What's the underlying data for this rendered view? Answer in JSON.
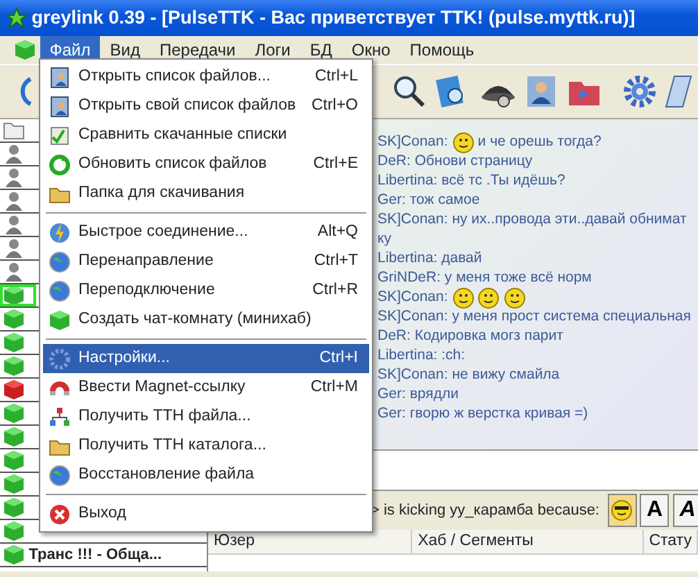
{
  "window": {
    "title": "greylink 0.39 - [PulseTTK - Вас приветствует TTK! (pulse.myttk.ru)]"
  },
  "menubar": [
    {
      "label": "Файл",
      "selected": true
    },
    {
      "label": "Вид",
      "selected": false
    },
    {
      "label": "Передачи",
      "selected": false
    },
    {
      "label": "Логи",
      "selected": false
    },
    {
      "label": "БД",
      "selected": false
    },
    {
      "label": "Окно",
      "selected": false
    },
    {
      "label": "Помощь",
      "selected": false
    }
  ],
  "file_menu": [
    {
      "kind": "list",
      "label": "Открыть список файлов...",
      "shortcut": "Ctrl+L",
      "selected": false
    },
    {
      "kind": "list",
      "label": "Открыть свой список файлов",
      "shortcut": "Ctrl+O",
      "selected": false
    },
    {
      "kind": "compare",
      "label": "Сравнить скачанные списки",
      "selected": false
    },
    {
      "kind": "refresh",
      "label": "Обновить список файлов",
      "shortcut": "Ctrl+E",
      "selected": false
    },
    {
      "kind": "folder",
      "label": "Папка для скачивания",
      "selected": false
    },
    {
      "kind": "separator"
    },
    {
      "kind": "bolt",
      "label": "Быстрое соединение...",
      "shortcut": "Alt+Q",
      "selected": false
    },
    {
      "kind": "globe",
      "label": "Перенаправление",
      "shortcut": "Ctrl+T",
      "selected": false
    },
    {
      "kind": "globe",
      "label": "Переподключение",
      "shortcut": "Ctrl+R",
      "selected": false
    },
    {
      "kind": "cube",
      "label": "Создать чат-комнату (минихаб)",
      "selected": false
    },
    {
      "kind": "separator"
    },
    {
      "kind": "gear",
      "label": "Настройки...",
      "shortcut": "Ctrl+I",
      "selected": true
    },
    {
      "kind": "magnet",
      "label": "Ввести Magnet-ссылку",
      "shortcut": "Ctrl+M",
      "selected": false
    },
    {
      "kind": "tree",
      "label": "Получить TTH файла...",
      "selected": false
    },
    {
      "kind": "folder",
      "label": "Получить TTH каталога...",
      "selected": false
    },
    {
      "kind": "globe",
      "label": "Восстановление файла",
      "selected": false
    },
    {
      "kind": "separator"
    },
    {
      "kind": "exit",
      "label": "Выход",
      "selected": false
    }
  ],
  "hub_list": [
    {
      "kind": "folder",
      "selected": false
    },
    {
      "kind": "user",
      "selected": false
    },
    {
      "kind": "user",
      "selected": false
    },
    {
      "kind": "user",
      "selected": false
    },
    {
      "kind": "user",
      "selected": false
    },
    {
      "kind": "user",
      "selected": false
    },
    {
      "kind": "user",
      "selected": false
    },
    {
      "kind": "hub",
      "selected": true
    },
    {
      "kind": "hub",
      "selected": false
    },
    {
      "kind": "hub",
      "selected": false
    },
    {
      "kind": "hub",
      "selected": false
    },
    {
      "kind": "hub-offline",
      "selected": false
    },
    {
      "kind": "hub",
      "selected": false
    },
    {
      "kind": "hub",
      "selected": false
    },
    {
      "kind": "hub",
      "selected": false
    },
    {
      "kind": "hub",
      "selected": false
    },
    {
      "kind": "hub",
      "selected": false
    },
    {
      "kind": "hub",
      "selected": false
    },
    {
      "kind": "hub",
      "label": "Транс !!! - Обща...",
      "selected": false
    }
  ],
  "chat": [
    [
      {
        "kind": "text",
        "text": "SK]Conan:"
      },
      {
        "kind": "smiley"
      },
      {
        "kind": "text",
        "text": "и че орешь тогда?"
      }
    ],
    [
      {
        "kind": "text",
        "text": "DeR: Обнови страницу"
      }
    ],
    [
      {
        "kind": "text",
        "text": "Libertina:  всё  тс .Ты идёшь?"
      }
    ],
    [
      {
        "kind": "text",
        "text": "Ger: тож самое"
      }
    ],
    [
      {
        "kind": "text",
        "text": "SK]Conan: ну их..провода эти..давай обнимат"
      }
    ],
    [
      {
        "kind": "text",
        "text": "ку"
      }
    ],
    [
      {
        "kind": "text",
        "text": "Libertina:  давай"
      }
    ],
    [
      {
        "kind": "text",
        "text": "GriNDeR:  у меня тоже всё норм"
      }
    ],
    [
      {
        "kind": "text",
        "text": "SK]Conan:"
      },
      {
        "kind": "smiley"
      },
      {
        "kind": "smiley"
      },
      {
        "kind": "smiley"
      }
    ],
    [
      {
        "kind": "text",
        "text": "SK]Conan: у меня прост система специальная"
      }
    ],
    [
      {
        "kind": "text",
        "text": "DeR: Кодировка могз парит"
      }
    ],
    [
      {
        "kind": "text",
        "text": "Libertina: :ch:"
      }
    ],
    [
      {
        "kind": "text",
        "text": "SK]Conan: не вижу смайла"
      }
    ],
    [
      {
        "kind": "text",
        "text": "Ger: врядли"
      }
    ],
    [
      {
        "kind": "text",
        "text": "Ger: гворю ж верстка кривая =)"
      }
    ]
  ],
  "status_text": "> is kicking yy_карамба because:",
  "format_buttons": [
    {
      "kind": "smiley"
    },
    {
      "kind": "bold",
      "text": "A"
    },
    {
      "kind": "italic",
      "text": "A"
    }
  ],
  "user_table": {
    "columns": [
      "Юзер",
      "Хаб / Сегменты",
      "Стату"
    ]
  }
}
